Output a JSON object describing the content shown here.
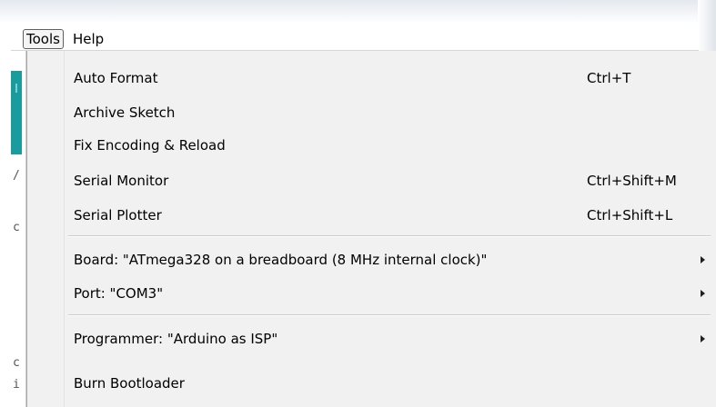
{
  "menubar": {
    "tools_label": "Tools",
    "help_label": "Help"
  },
  "editor_strip": {
    "glyphs": [
      "/",
      "c",
      "c",
      "i"
    ]
  },
  "tools_menu": {
    "auto_format": {
      "label": "Auto Format",
      "shortcut": "Ctrl+T"
    },
    "archive_sketch": {
      "label": "Archive Sketch"
    },
    "fix_encoding": {
      "label": "Fix Encoding & Reload"
    },
    "serial_monitor": {
      "label": "Serial Monitor",
      "shortcut": "Ctrl+Shift+M"
    },
    "serial_plotter": {
      "label": "Serial Plotter",
      "shortcut": "Ctrl+Shift+L"
    },
    "board": {
      "label": "Board: \"ATmega328 on a breadboard (8 MHz internal clock)\""
    },
    "port": {
      "label": "Port: \"COM3\""
    },
    "programmer": {
      "label": "Programmer: \"Arduino as ISP\""
    },
    "burn_bootloader": {
      "label": "Burn Bootloader"
    }
  },
  "colors": {
    "menu_background": "#f1f1f1",
    "editor_accent": "#1a9b9e"
  },
  "icons": {
    "submenu": "chevron-right-icon"
  }
}
